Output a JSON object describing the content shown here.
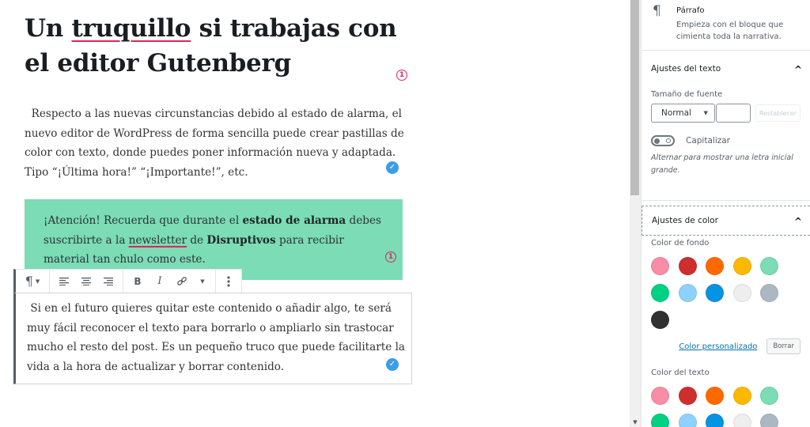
{
  "editor": {
    "title_parts": [
      "Un ",
      "truquillo",
      " si trabajas con el editor Gutenberg"
    ],
    "title_badge": "1",
    "paragraph1": "Respecto a las nuevas circunstancias debido al estado de alarma, el nuevo editor de WordPress de forma sencilla puede crear pastillas de color con texto, donde puedes poner información nueva y adaptada. Tipo “¡Última hora!” “¡Importante!”, etc.",
    "paragraph1_badge": "✓",
    "callout": {
      "background": "#7bdcb5",
      "parts": [
        {
          "text": "¡Atención! Recuerda que durante el ",
          "style": "normal"
        },
        {
          "text": "estado de alarma",
          "style": "bold"
        },
        {
          "text": " debes suscribirte a la ",
          "style": "normal"
        },
        {
          "text": "newsletter",
          "style": "spell"
        },
        {
          "text": " de ",
          "style": "normal"
        },
        {
          "text": "Disruptivos",
          "style": "bold"
        },
        {
          "text": " para recibir material tan chulo como este.",
          "style": "normal"
        }
      ],
      "badge": "1"
    },
    "toolbar": {
      "buttons": [
        {
          "name": "block-type",
          "icon": "pilcrow-icon"
        },
        {
          "name": "align-left",
          "icon": "align-left-icon"
        },
        {
          "name": "align-center",
          "icon": "align-center-icon"
        },
        {
          "name": "align-right",
          "icon": "align-right-icon"
        },
        {
          "name": "bold",
          "label": "B"
        },
        {
          "name": "italic",
          "label": "I"
        },
        {
          "name": "link",
          "icon": "link-icon"
        },
        {
          "name": "more-formats",
          "icon": "chevron-down-icon"
        },
        {
          "name": "more-options",
          "icon": "ellipsis-vertical-icon"
        }
      ],
      "bold_label": "B",
      "italic_label": "I"
    },
    "selected_paragraph": "Si en el futuro quieres quitar este contenido o añadir algo, te será muy fácil reconocer el texto para borrarlo o ampliarlo sin trastocar mucho el resto del post. Es un pequeño truco que puede facilitarte la vida a la hora de actualizar y borrar contenido.",
    "selected_badge": "✓"
  },
  "sidebar": {
    "block_card": {
      "icon": "¶",
      "title": "Párrafo",
      "description": "Empieza con el bloque que cimienta toda la narrativa."
    },
    "text_settings": {
      "title": "Ajustes del texto",
      "font_size_label": "Tamaño de fuente",
      "font_size_value": "Normal",
      "custom_size_value": "",
      "reset_label": "Restablecer",
      "drop_cap_label": "Capitalizar",
      "drop_cap_enabled": false,
      "drop_cap_help": "Alternar para mostrar una letra inicial grande."
    },
    "color_settings": {
      "title": "Ajustes de color",
      "background_label": "Color de fondo",
      "background_colors": [
        "#f78da7",
        "#cf2e2e",
        "#ff6900",
        "#fcb900",
        "#7bdcb5",
        "#00d084",
        "#8ed1fc",
        "#0693e3",
        "#eeeeee",
        "#abb8c3",
        "#313131"
      ],
      "custom_color_label": "Color personalizado",
      "clear_label": "Borrar",
      "text_label": "Color del texto",
      "text_colors": [
        "#f78da7",
        "#cf2e2e",
        "#ff6900",
        "#fcb900",
        "#7bdcb5",
        "#00d084",
        "#8ed1fc",
        "#0693e3",
        "#eeeeee",
        "#abb8c3"
      ]
    }
  }
}
